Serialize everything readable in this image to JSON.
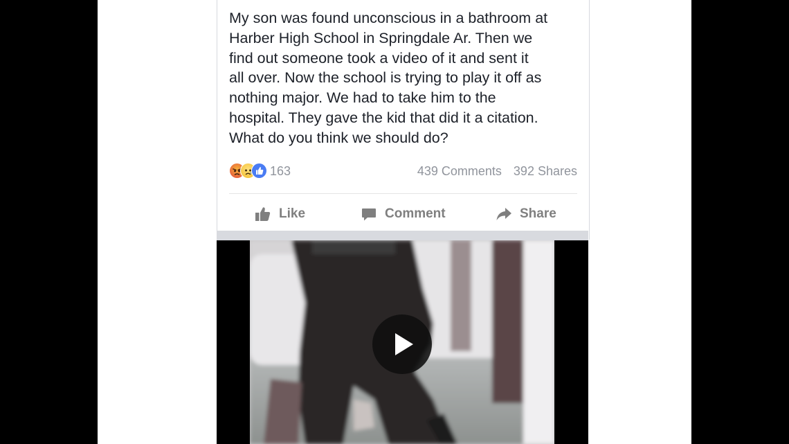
{
  "post": {
    "text": "My son was found unconscious in a bathroom at\nHarber High School in Springdale Ar. Then we\nfind out someone took a video of it and sent it\nall over. Now the school is trying to play it off as\nnothing major.  We had to take him to the\nhospital.  They gave the kid that did it a citation.\nWhat do you think we should do?",
    "reactions": {
      "icons": [
        "angry-reaction-icon",
        "sad-reaction-icon",
        "like-reaction-icon"
      ],
      "count": "163"
    },
    "comments_count": "439 Comments",
    "shares_count": "392 Shares"
  },
  "actions": {
    "like_label": "Like",
    "comment_label": "Comment",
    "share_label": "Share",
    "icon_names": [
      "thumbs-up-icon",
      "comment-bubble-icon",
      "share-arrow-icon"
    ]
  },
  "video": {
    "controls": [
      "play-icon"
    ]
  },
  "colors": {
    "text": "#1d2129",
    "meta": "#90949c",
    "action": "#7f7f7f",
    "like_blue": "#4a7cf3",
    "background_bars": "#000000"
  }
}
